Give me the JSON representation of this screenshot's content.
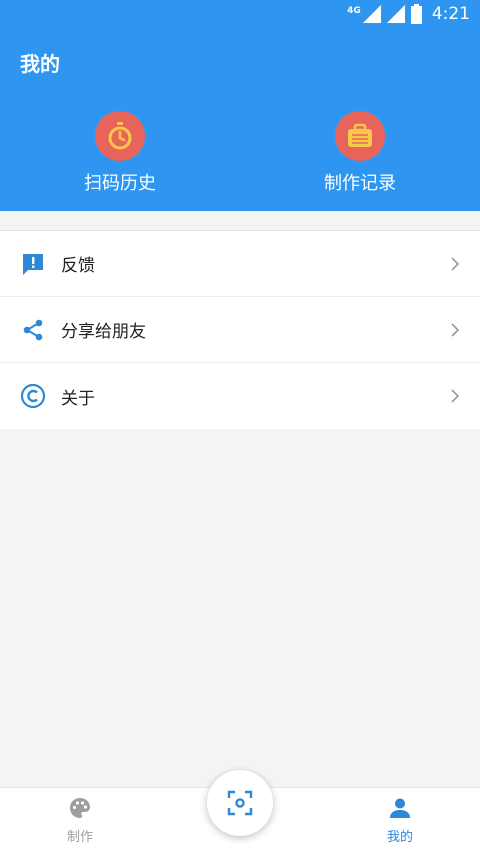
{
  "statusbar": {
    "network": "4G",
    "time": "4:21",
    "icons": [
      "signal-icon",
      "signal-icon",
      "battery-icon"
    ]
  },
  "header": {
    "title": "我的",
    "shortcuts": [
      {
        "label": "扫码历史",
        "icon": "stopwatch-icon"
      },
      {
        "label": "制作记录",
        "icon": "briefcase-icon"
      }
    ]
  },
  "menu": {
    "items": [
      {
        "label": "反馈",
        "icon": "feedback-icon"
      },
      {
        "label": "分享给朋友",
        "icon": "share-icon"
      },
      {
        "label": "关于",
        "icon": "copyright-icon"
      }
    ]
  },
  "bottom_nav": {
    "tabs": [
      {
        "label": "制作",
        "icon": "palette-icon",
        "active": false
      },
      {
        "label": "我的",
        "icon": "person-icon",
        "active": true
      }
    ],
    "fab_icon": "scan-icon"
  },
  "colors": {
    "primary": "#2e96f0",
    "shortcut_bg": "#e8645a",
    "inactive": "#9e9e9e"
  }
}
